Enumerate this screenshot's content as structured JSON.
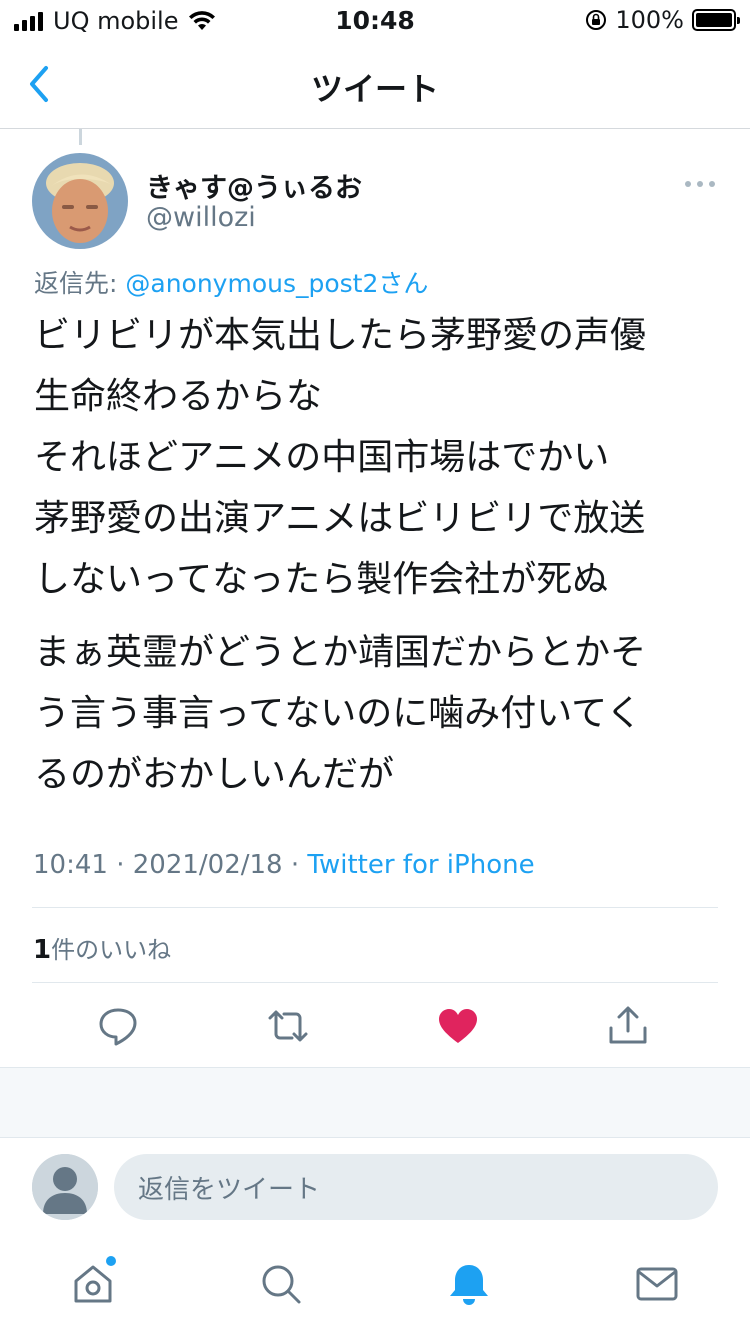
{
  "status_bar": {
    "carrier": "UQ mobile",
    "time": "10:48",
    "battery_percent": "100%",
    "battery_level": 1.0
  },
  "nav": {
    "title": "ツイート"
  },
  "tweet": {
    "display_name": "きゃす@うぃるお",
    "handle": "@willozi",
    "reply_label": "返信先: ",
    "reply_mention": "@anonymous_post2",
    "reply_suffix": "さん",
    "paragraph1": [
      "ビリビリが本気出したら茅野愛の声優",
      "生命終わるからな",
      "それほどアニメの中国市場はでかい",
      "茅野愛の出演アニメはビリビリで放送",
      "しないってなったら製作会社が死ぬ"
    ],
    "paragraph2": [
      "まぁ英霊がどうとか靖国だからとかそ",
      "う言う事言ってないのに噛み付いてく",
      "るのがおかしいんだが"
    ],
    "time": "10:41",
    "separator": " · ",
    "date": "2021/02/18",
    "source": "Twitter for iPhone",
    "like_count": "1",
    "like_label": "件のいいね",
    "liked": true
  },
  "composer": {
    "placeholder": "返信をツイート"
  },
  "icons": {
    "back": "chevron-left-icon",
    "more": "more-icon",
    "reply": "reply-icon",
    "retweet": "retweet-icon",
    "like": "heart-icon",
    "share": "share-icon",
    "home": "home-icon",
    "search": "search-icon",
    "notifications": "bell-icon",
    "messages": "mail-icon"
  },
  "colors": {
    "accent": "#1da1f2",
    "like": "#e0245e",
    "muted": "#657786",
    "text": "#14171a"
  }
}
